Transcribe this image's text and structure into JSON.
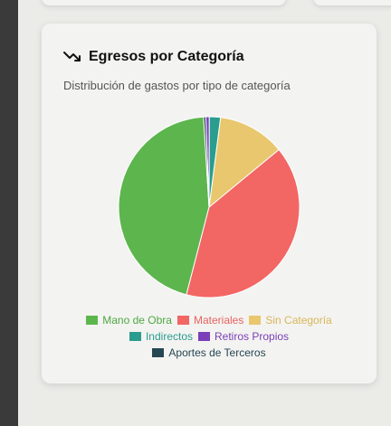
{
  "card": {
    "title": "Egresos por Categoría",
    "subtitle": "Distribución de gastos por tipo de categoría"
  },
  "icons": {
    "title_icon": "trending-down-icon"
  },
  "chart_data": {
    "type": "pie",
    "title": "Egresos por Categoría",
    "slices": [
      {
        "label": "Mano de Obra",
        "value": 45.0,
        "color": "#5db54e",
        "text_color": "#4fa744"
      },
      {
        "label": "Materiales",
        "value": 40.0,
        "color": "#f26664",
        "text_color": "#e8625e"
      },
      {
        "label": "Sin Categoría",
        "value": 12.0,
        "color": "#e8c76e",
        "text_color": "#d9b65a"
      },
      {
        "label": "Indirectos",
        "value": 2.0,
        "color": "#2a9d8f",
        "text_color": "#2a9d8f"
      },
      {
        "label": "Retiros Propios",
        "value": 0.6,
        "color": "#7b3fb8",
        "text_color": "#7b3fb8"
      },
      {
        "label": "Aportes de Terceros",
        "value": 0.4,
        "color": "#264653",
        "text_color": "#264653"
      }
    ],
    "start_angle_deg": 93.5,
    "direction": "counterclockwise",
    "legend_position": "bottom"
  }
}
